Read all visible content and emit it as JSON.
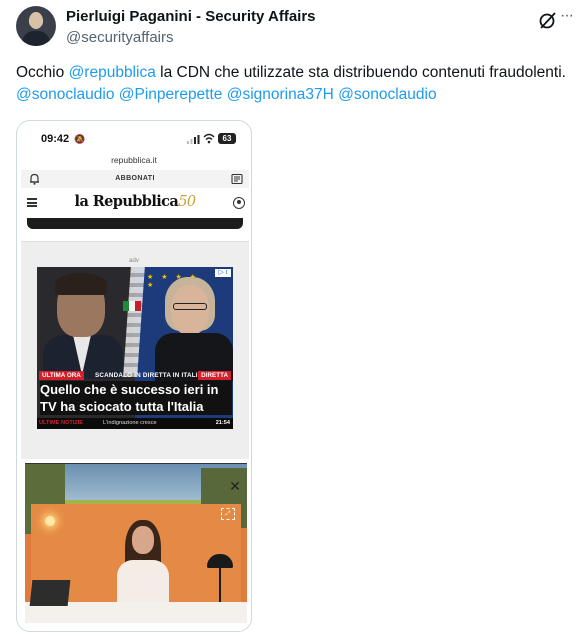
{
  "tweet": {
    "author_name": "Pierluigi Paganini - Security Affairs",
    "author_handle": "@securityaffairs",
    "text_prefix": "Occhio ",
    "mention_1": "@repubblica",
    "text_middle": " la CDN che utilizzate sta distribuendo contenuti fraudolenti. ",
    "mentions": [
      "@sonoclaudio",
      "@Pinperepette",
      "@signorina37H",
      "@sonoclaudio"
    ]
  },
  "icons": {
    "avatar": "avatar",
    "grok": "grok-icon",
    "more": "more-icon"
  },
  "screenshot": {
    "status_time": "09:42",
    "battery": "63",
    "url": "repubblica.it",
    "subscribe": "ABBONATI",
    "logo_text": "la Repubblica",
    "logo_suffix": "50",
    "adv_label": "adv",
    "ad": {
      "breaking_label": "ULTIMA ORA",
      "scandal_label": "SCANDALO IN DIRETTA IN ITALIA",
      "live_label": "DIRETTA",
      "headline": "Quello che è successo ieri in TV ha sciocato tutta l'Italia",
      "footer_label": "ULTIME NOTIZIE",
      "footer_sub": "L'indignazione cresce",
      "footer_time": "21:54",
      "info_badge": "▷ i"
    }
  },
  "colors": {
    "mention": "#1d9bf0",
    "secondary_text": "#536471",
    "breaking_red": "#d3202a"
  }
}
